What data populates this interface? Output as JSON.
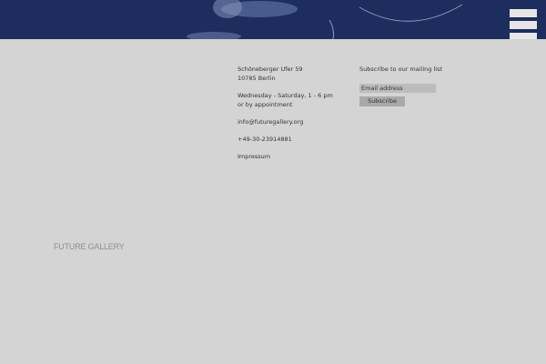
{
  "hero": {
    "background_color": "#1c2d5e",
    "image_description_icon": "gallery-artwork-image"
  },
  "menu": {
    "icon": "hamburger-menu-icon"
  },
  "contact": {
    "address_line1": "Schöneberger Ufer 59",
    "address_line2": "10785 Berlin",
    "hours_line1": "Wednesday - Saturday, 1 - 6 pm",
    "hours_line2": "or by appointment",
    "email": "info@futuregallery.org",
    "phone": "+49-30-23914881",
    "impressum": "Impressum"
  },
  "newsletter": {
    "title": "Subscribe to our mailing list",
    "email_placeholder": "Email address",
    "subscribe_label": "Subscribe"
  },
  "brand": {
    "name": "FUTURE GALLERY"
  }
}
